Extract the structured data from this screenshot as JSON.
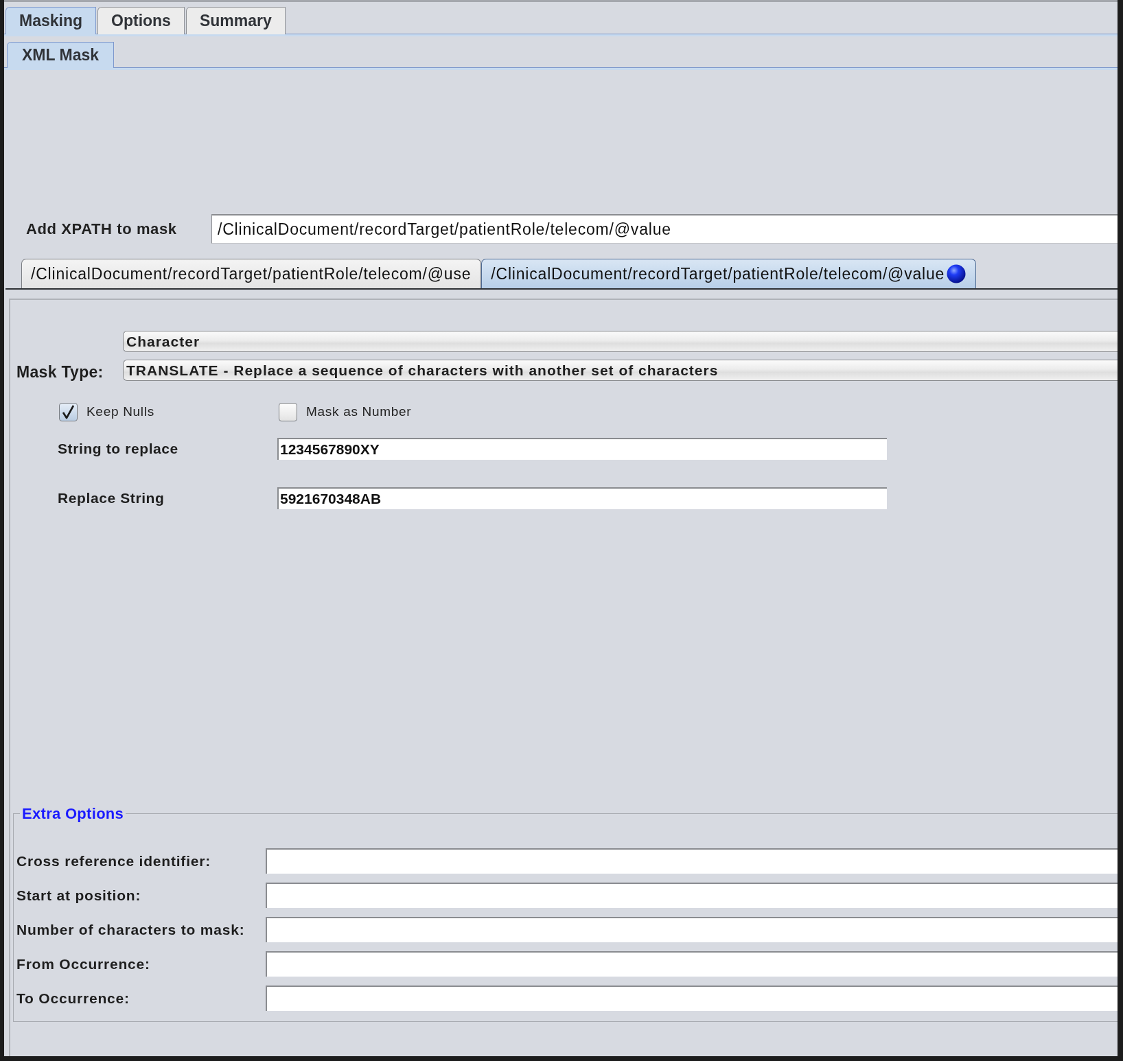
{
  "main_tabs": [
    {
      "label": "Masking",
      "selected": true
    },
    {
      "label": "Options",
      "selected": false
    },
    {
      "label": "Summary",
      "selected": false
    }
  ],
  "sub_tabs": [
    {
      "label": "XML Mask",
      "selected": true
    }
  ],
  "xpath": {
    "label": "Add XPATH to mask",
    "value": "/ClinicalDocument/recordTarget/patientRole/telecom/@value"
  },
  "xpath_tabs": [
    {
      "label": "/ClinicalDocument/recordTarget/patientRole/telecom/@use",
      "selected": false,
      "marked": false
    },
    {
      "label": "/ClinicalDocument/recordTarget/patientRole/telecom/@value",
      "selected": true,
      "marked": true
    }
  ],
  "mask_type": {
    "label": "Mask Type:",
    "category": "Character",
    "type": "TRANSLATE - Replace a sequence of characters with another set of characters"
  },
  "checkboxes": [
    {
      "label": "Keep Nulls",
      "checked": true
    },
    {
      "label": "Mask as Number",
      "checked": false
    }
  ],
  "fields": [
    {
      "label": "String to replace",
      "value": "1234567890XY"
    },
    {
      "label": "Replace String",
      "value": "5921670348AB"
    }
  ],
  "extra_options": {
    "title": "Extra Options",
    "fields": [
      {
        "label": "Cross reference identifier:"
      },
      {
        "label": "Start at position:"
      },
      {
        "label": "Number of characters to mask:"
      },
      {
        "label": "From Occurrence:"
      },
      {
        "label": "To Occurrence:"
      }
    ]
  }
}
